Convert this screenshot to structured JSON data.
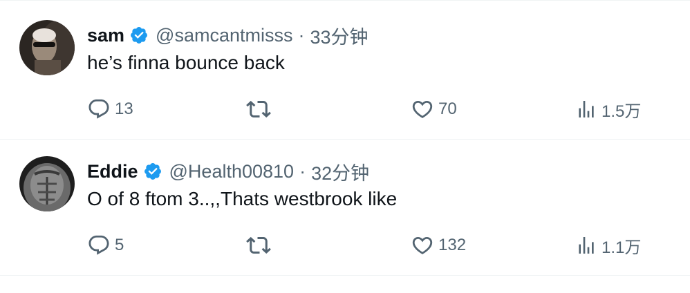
{
  "colors": {
    "verified_blue": "#1d9bf0",
    "secondary_text": "#536471",
    "primary_text": "#0f1419",
    "divider": "#eff3f4"
  },
  "tweets": [
    {
      "name": "sam",
      "handle": "@samcantmisss",
      "separator": "·",
      "time": "33分钟",
      "text": "he’s finna bounce back",
      "replies": "13",
      "retweets": "",
      "likes": "70",
      "views": "1.5万",
      "icons": [
        "avatar-photo",
        "verified-badge-icon",
        "reply-icon",
        "retweet-icon",
        "like-icon",
        "views-icon"
      ]
    },
    {
      "name": "Eddie",
      "handle": "@Health00810",
      "separator": "·",
      "time": "32分钟",
      "text": "O of 8 ftom 3..,,Thats westbrook like",
      "replies": "5",
      "retweets": "",
      "likes": "132",
      "views": "1.1万",
      "icons": [
        "avatar-photo",
        "verified-badge-icon",
        "reply-icon",
        "retweet-icon",
        "like-icon",
        "views-icon"
      ]
    }
  ]
}
